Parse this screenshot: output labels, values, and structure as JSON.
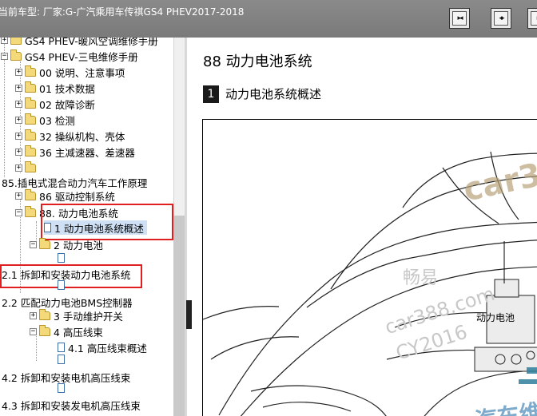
{
  "header": {
    "vehicle_label": "当前车型:   厂家:G-广汽乘用车传祺GS4 PHEV2017-2018",
    "buttons": [
      {
        "name": "expand-pane-button",
        "icon": "pane-right-icon"
      },
      {
        "name": "split-pane-button",
        "icon": "pane-split-icon"
      },
      {
        "name": "collapse-pane-button",
        "icon": "pane-left-icon"
      }
    ]
  },
  "tree": {
    "items": [
      {
        "label": "GS4 PHEV-暖风空调维修手册"
      },
      {
        "label": "GS4 PHEV-三电维修手册"
      },
      {
        "label": "00 说明、注意事项"
      },
      {
        "label": "01 技术数据"
      },
      {
        "label": "02 故障诊断"
      },
      {
        "label": "03 检测"
      },
      {
        "label": "32 操纵机构、壳体"
      },
      {
        "label": "36 主减速器、差速器"
      },
      {
        "label": ""
      },
      {
        "label": "85.插电式混合动力汽车工作原理"
      },
      {
        "label": "86 驱动控制系统"
      },
      {
        "label": "88. 动力电池系统"
      },
      {
        "label": "1 动力电池系统概述"
      },
      {
        "label": "2 动力电池"
      },
      {
        "label": "2.1 拆卸和安装动力电池系统"
      },
      {
        "label": "2.2 匹配动力电池BMS控制器"
      },
      {
        "label": "3 手动维护开关"
      },
      {
        "label": "4 高压线束"
      },
      {
        "label": "4.1 高压线束概述"
      },
      {
        "label": "4.2 拆卸和安装电机高压线束"
      },
      {
        "label": "4.3 拆卸和安装发电机高压线束"
      }
    ]
  },
  "content": {
    "chapter_title": "88   动力电池系统",
    "section_number": "1",
    "section_title": "动力电池系统概述",
    "figure_label": "动力电池",
    "watermarks": [
      "car388",
      "畅易",
      "car388.com",
      "CY2016",
      "汽车维"
    ]
  },
  "colors": {
    "topbar": "#808080",
    "highlight_box": "#e02020",
    "selection": "#cfe0f4",
    "folder": "#f3d97a"
  }
}
